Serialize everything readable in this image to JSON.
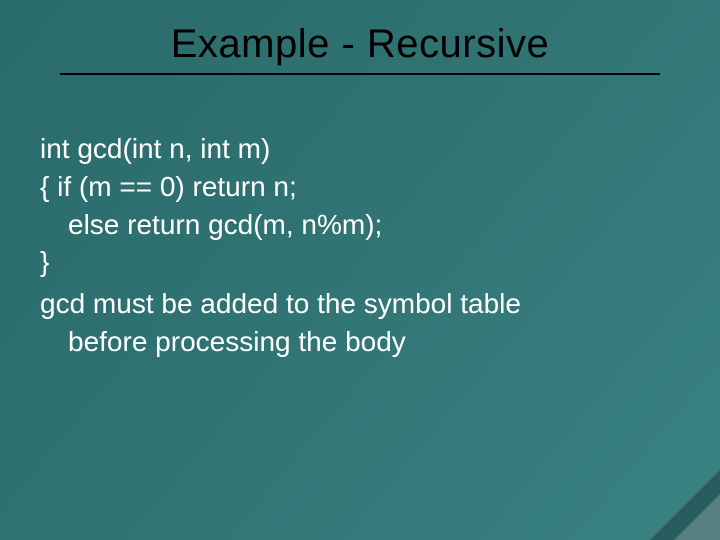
{
  "title": "Example - Recursive",
  "code": {
    "l1": "int gcd(int n, int m)",
    "l2": "{ if (m == 0) return n;",
    "l3": "else return gcd(m, n%m);",
    "l4": "}"
  },
  "note": {
    "part1": "gcd must be added to the symbol table",
    "before": "before",
    "part2": " processing the body"
  }
}
